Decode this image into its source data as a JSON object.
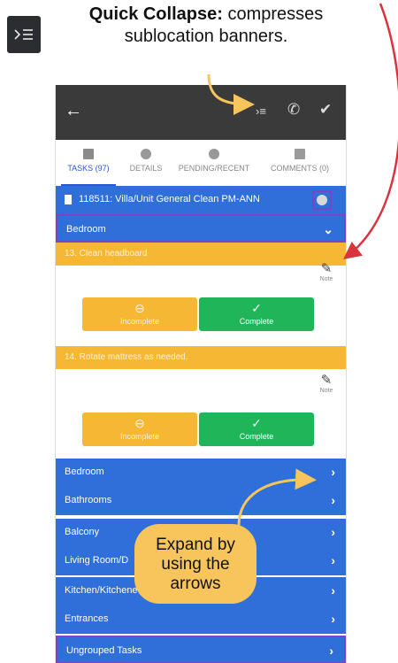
{
  "callout_top": {
    "bold": "Quick Collapse:",
    "rest_line1": " compresses",
    "line2": "sublocation banners."
  },
  "app": {
    "tabs": [
      {
        "label": "TASKS (97)",
        "icon": "list-icon"
      },
      {
        "label": "DETAILS",
        "icon": "info-icon"
      },
      {
        "label": "PENDING/RECENT",
        "icon": "clock-icon"
      },
      {
        "label": "COMMENTS (0)",
        "icon": "image-icon"
      }
    ],
    "work_order": "118511: Villa/Unit General Clean PM-ANN",
    "expanded_section": "Bedroom",
    "tasks": [
      {
        "title": "13. Clean headboard",
        "note": "Note",
        "incomplete": "Incomplete",
        "complete": "Complete"
      },
      {
        "title": "14. Rotate mattress as needed.",
        "note": "Note",
        "incomplete": "Incomplete",
        "complete": "Complete"
      }
    ],
    "sections": [
      "Bedroom",
      "Bathrooms",
      "Balcony",
      "Living Room/D",
      "Kitchen/Kitchene",
      "Entrances",
      "Ungrouped Tasks"
    ]
  },
  "callout_bottom": {
    "line1": "Expand by",
    "line2": "using the",
    "line3": "arrows"
  },
  "colors": {
    "accent_blue": "#2e6fd9",
    "task_orange": "#f6b733",
    "complete_green": "#1fb659",
    "annotation_red": "#d9343e",
    "annotation_purple": "#7b44c6"
  }
}
